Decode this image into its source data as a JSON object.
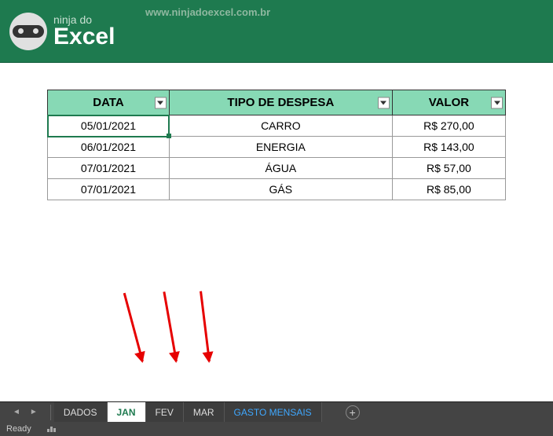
{
  "header": {
    "logo_small": "ninja do",
    "logo_big": "Excel",
    "url": "www.ninjadoexcel.com.br"
  },
  "table": {
    "headers": {
      "data": "DATA",
      "tipo": "TIPO DE DESPESA",
      "valor": "VALOR"
    },
    "rows": [
      {
        "data": "05/01/2021",
        "tipo": "CARRO",
        "valor": "R$ 270,00"
      },
      {
        "data": "06/01/2021",
        "tipo": "ENERGIA",
        "valor": "R$ 143,00"
      },
      {
        "data": "07/01/2021",
        "tipo": "ÁGUA",
        "valor": "R$ 57,00"
      },
      {
        "data": "07/01/2021",
        "tipo": "GÁS",
        "valor": "R$ 85,00"
      }
    ]
  },
  "tabs": {
    "items": [
      {
        "label": "DADOS"
      },
      {
        "label": "JAN"
      },
      {
        "label": "FEV"
      },
      {
        "label": "MAR"
      },
      {
        "label": "GASTO MENSAIS"
      }
    ],
    "active_index": 1,
    "highlight_index": 4
  },
  "statusbar": {
    "ready": "Ready"
  }
}
